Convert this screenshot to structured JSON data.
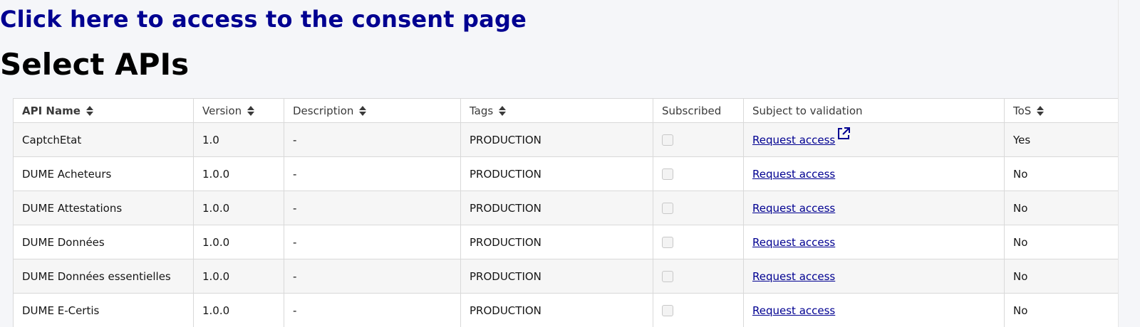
{
  "header": {
    "consent_link": "Click here to access to the consent page",
    "title": "Select APIs"
  },
  "table": {
    "columns": [
      {
        "label": "API Name",
        "sortable": true
      },
      {
        "label": "Version",
        "sortable": true
      },
      {
        "label": "Description",
        "sortable": true
      },
      {
        "label": "Tags",
        "sortable": true
      },
      {
        "label": "Subscribed",
        "sortable": false
      },
      {
        "label": "Subject to validation",
        "sortable": false
      },
      {
        "label": "ToS",
        "sortable": true
      }
    ],
    "rows": [
      {
        "name": "CaptchEtat",
        "version": "1.0",
        "description": "-",
        "tags": "PRODUCTION",
        "subscribed": false,
        "validation": "Request access",
        "external": true,
        "tos": "Yes"
      },
      {
        "name": "DUME Acheteurs",
        "version": "1.0.0",
        "description": "-",
        "tags": "PRODUCTION",
        "subscribed": false,
        "validation": "Request access",
        "external": false,
        "tos": "No"
      },
      {
        "name": "DUME Attestations",
        "version": "1.0.0",
        "description": "-",
        "tags": "PRODUCTION",
        "subscribed": false,
        "validation": "Request access",
        "external": false,
        "tos": "No"
      },
      {
        "name": "DUME Données",
        "version": "1.0.0",
        "description": "-",
        "tags": "PRODUCTION",
        "subscribed": false,
        "validation": "Request access",
        "external": false,
        "tos": "No"
      },
      {
        "name": "DUME Données essentielles",
        "version": "1.0.0",
        "description": "-",
        "tags": "PRODUCTION",
        "subscribed": false,
        "validation": "Request access",
        "external": false,
        "tos": "No"
      },
      {
        "name": "DUME E-Certis",
        "version": "1.0.0",
        "description": "-",
        "tags": "PRODUCTION",
        "subscribed": false,
        "validation": "Request access",
        "external": false,
        "tos": "No"
      }
    ]
  },
  "colors": {
    "link": "#000091",
    "background": "#f5f6f9"
  },
  "icons": {
    "sort": "sort-icon",
    "external": "external-link-icon"
  }
}
